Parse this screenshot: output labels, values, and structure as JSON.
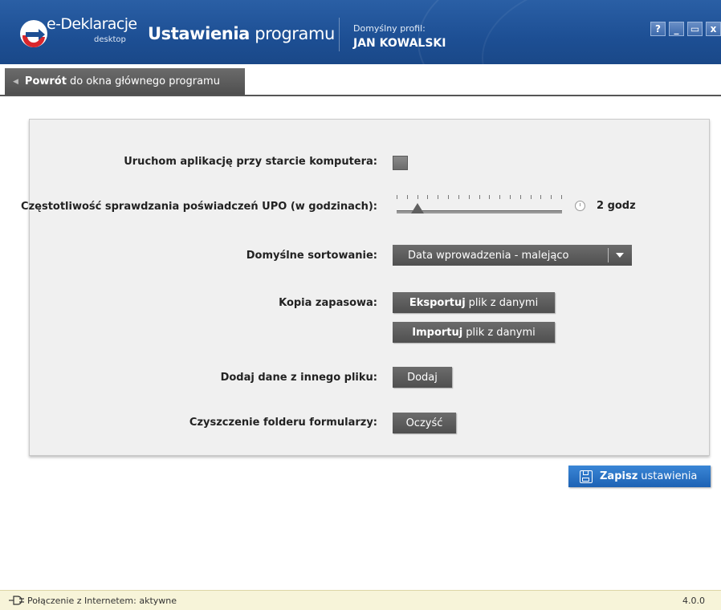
{
  "header": {
    "brand_name": "e-Deklaracje",
    "brand_sub": "desktop",
    "title_bold": "Ustawienia",
    "title_rest": "programu",
    "profile_label": "Domyślny profil:",
    "profile_name": "JAN KOWALSKI",
    "buttons": {
      "help": "?",
      "minimize": "_",
      "maximize": "▭",
      "close": "x"
    }
  },
  "back": {
    "bold": "Powrót",
    "rest": "do okna głównego programu"
  },
  "settings": {
    "autostart_label": "Uruchom aplikację przy starcie komputera:",
    "frequency_label": "Częstotliwość sprawdzania poświadczeń UPO (w godzinach):",
    "frequency_value": "2 godz",
    "frequency_fraction": 0.125,
    "sort_label": "Domyślne sortowanie:",
    "sort_value": "Data wprowadzenia - malejąco",
    "backup_label": "Kopia zapasowa:",
    "export_bold": "Eksportuj",
    "export_rest": "plik z danymi",
    "import_bold": "Importuj",
    "import_rest": "plik z danymi",
    "add_label": "Dodaj dane z innego pliku:",
    "add_button": "Dodaj",
    "clean_label": "Czyszczenie folderu formularzy:",
    "clean_button": "Oczyść"
  },
  "save": {
    "bold": "Zapisz",
    "rest": "ustawienia"
  },
  "status": {
    "connection": "Połączenie z Internetem: aktywne",
    "version": "4.0.0"
  },
  "colors": {
    "header_blue": "#1d4f94",
    "button_gray": "#5c5c5c",
    "save_blue": "#2a74c7",
    "status_bg": "#f7f4d9"
  }
}
